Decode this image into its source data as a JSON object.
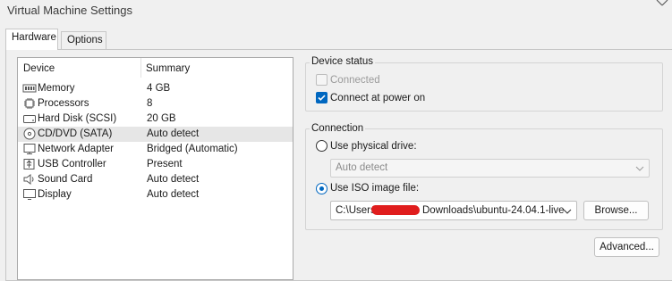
{
  "window": {
    "title": "Virtual Machine Settings"
  },
  "tabs": [
    {
      "label": "Hardware",
      "active": true
    },
    {
      "label": "Options",
      "active": false
    }
  ],
  "device_list": {
    "columns": [
      "Device",
      "Summary"
    ],
    "rows": [
      {
        "icon": "memory-icon",
        "name": "Memory",
        "summary": "4 GB",
        "selected": false
      },
      {
        "icon": "processor-icon",
        "name": "Processors",
        "summary": "8",
        "selected": false
      },
      {
        "icon": "hard-disk-icon",
        "name": "Hard Disk (SCSI)",
        "summary": "20 GB",
        "selected": false
      },
      {
        "icon": "cd-dvd-icon",
        "name": "CD/DVD (SATA)",
        "summary": "Auto detect",
        "selected": true
      },
      {
        "icon": "network-adapter-icon",
        "name": "Network Adapter",
        "summary": "Bridged (Automatic)",
        "selected": false
      },
      {
        "icon": "usb-controller-icon",
        "name": "USB Controller",
        "summary": "Present",
        "selected": false
      },
      {
        "icon": "sound-card-icon",
        "name": "Sound Card",
        "summary": "Auto detect",
        "selected": false
      },
      {
        "icon": "display-icon",
        "name": "Display",
        "summary": "Auto detect",
        "selected": false
      }
    ]
  },
  "device_status": {
    "title": "Device status",
    "connected_label": "Connected",
    "connected_checked": false,
    "connected_enabled": false,
    "power_on_label": "Connect at power on",
    "power_on_checked": true
  },
  "connection": {
    "title": "Connection",
    "physical_label": "Use physical drive:",
    "physical_selected": false,
    "physical_value": "Auto detect",
    "iso_label": "Use ISO image file:",
    "iso_selected": true,
    "iso_path_start": "C:\\Users",
    "iso_path_end": "Downloads\\ubuntu-24.04.1-live",
    "browse_label": "Browse...",
    "redaction_color": "#e01d1d"
  },
  "advanced_label": "Advanced...",
  "colors": {
    "accent": "#0067c0",
    "selected_row": "#e6e6e6"
  }
}
